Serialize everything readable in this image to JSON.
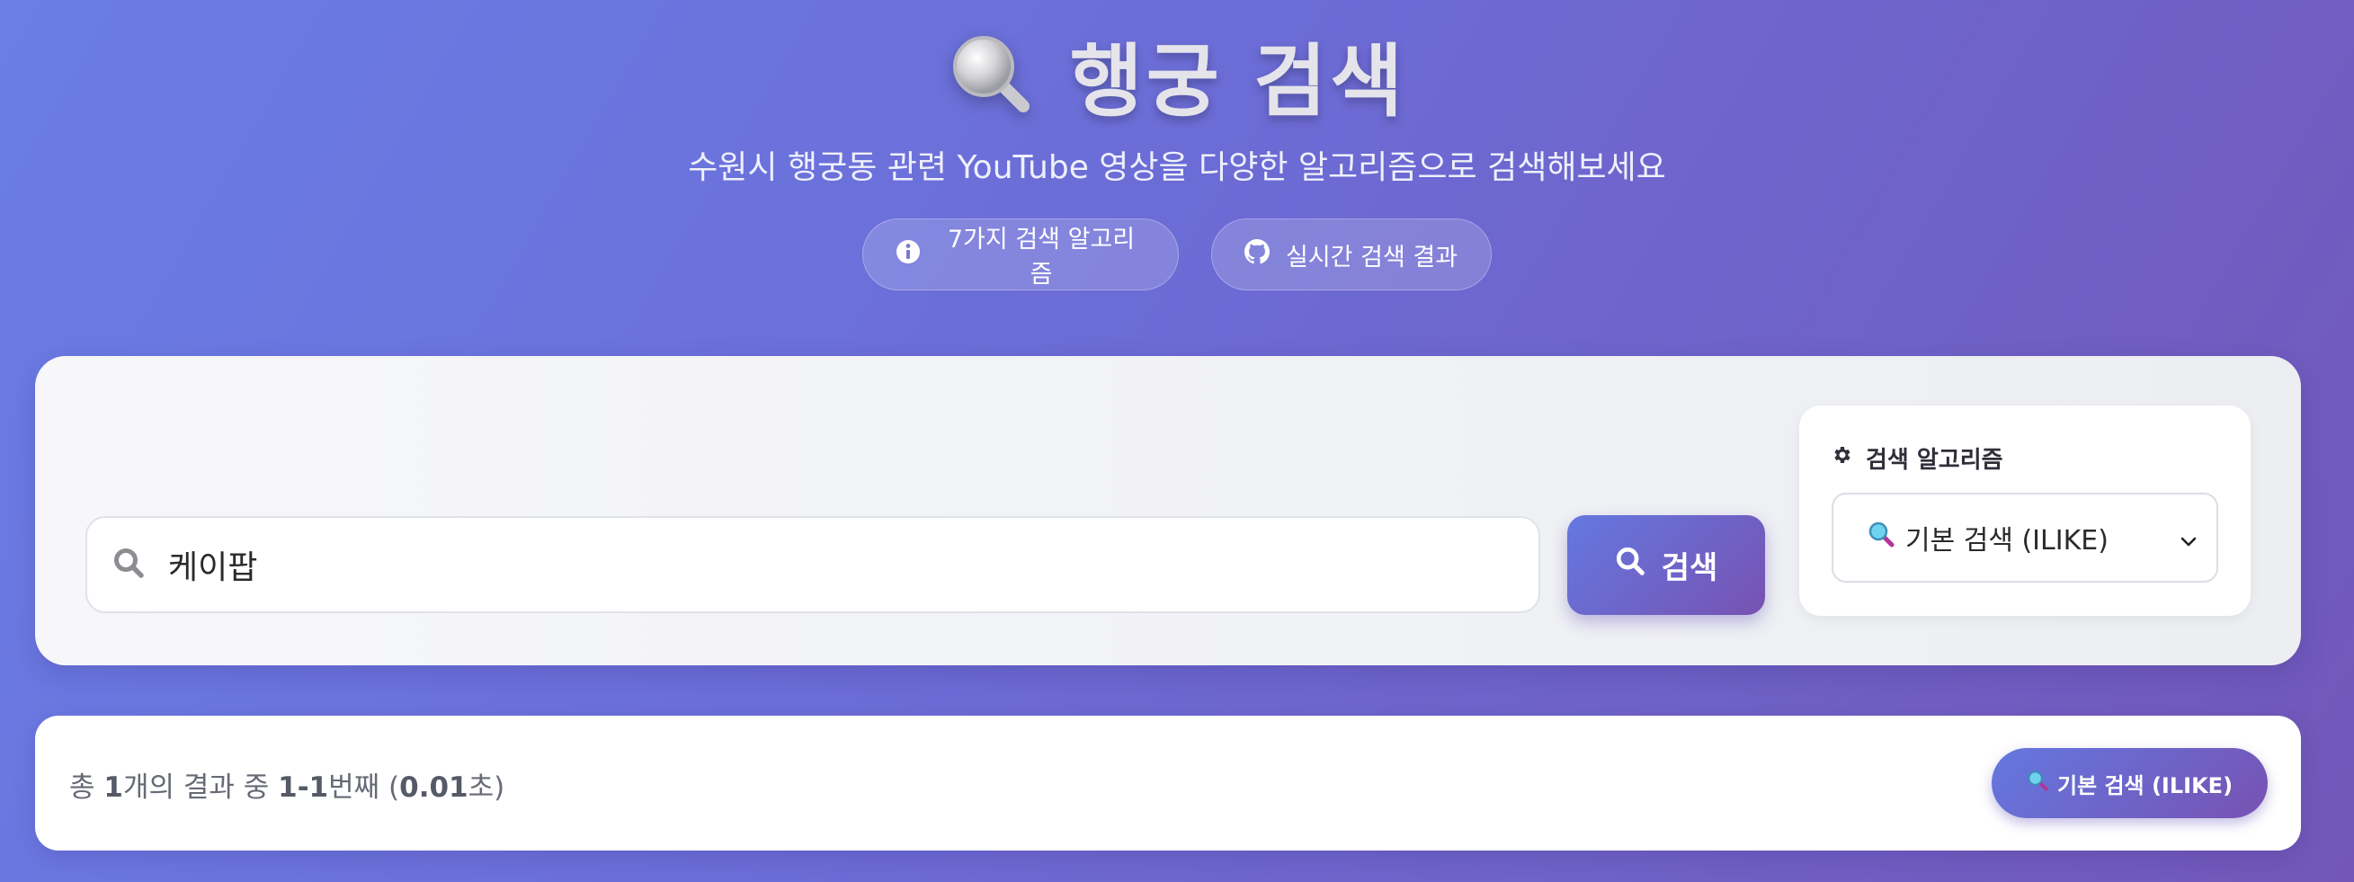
{
  "header": {
    "title": "행궁 검색",
    "subtitle": "수원시 행궁동 관련 YouTube 영상을 다양한 알고리즘으로 검색해보세요",
    "pills": [
      {
        "icon": "info-circle-icon",
        "label": "7가지 검색 알고리즘"
      },
      {
        "icon": "github-icon",
        "label": "실시간 검색 결과"
      }
    ]
  },
  "search": {
    "query": "케이팝",
    "button_label": "검색",
    "algorithm_label": "검색 알고리즘",
    "algorithm_selected": "기본 검색 (ILIKE)"
  },
  "results": {
    "summary_prefix": "총 ",
    "total": "1",
    "summary_mid": "개의 결과 중 ",
    "range": "1-1",
    "summary_unit": "번째 (",
    "time": "0.01",
    "summary_suffix": "초)",
    "algorithm_badge": "기본 검색 (ILIKE)"
  },
  "colors": {
    "accent_start": "#6478e0",
    "accent_end": "#7752b2",
    "background_start": "#6a7ee6",
    "background_end": "#7257b8"
  }
}
